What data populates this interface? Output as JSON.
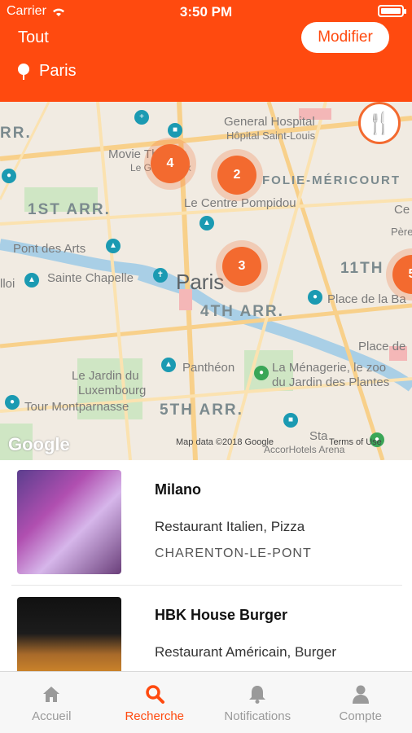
{
  "status_bar": {
    "carrier": "Carrier",
    "time": "3:50 PM"
  },
  "header": {
    "title": "Tout",
    "edit_label": "Modifier",
    "location": "Paris",
    "accent_color": "#ff4a0f"
  },
  "map": {
    "labels": {
      "arr_left": "RR.",
      "movie_theater": "Movie Theater",
      "le_grand_rex": "Le Grand Rex",
      "general_hospital": "General Hospital",
      "hopital": "Hôpital Saint-Louis",
      "folie": "FOLIE-MÉRICOURT",
      "first_arr": "1ST ARR.",
      "pompidou": "Le Centre Pompidou",
      "pont_des_arts": "Pont des Arts",
      "louvre_left": "lloi",
      "sainte_chapelle": "Sainte Chapelle",
      "paris": "Paris",
      "fourth_arr": "4TH ARR.",
      "eleventh": "11TH",
      "place_bastille": "Place de la Ba",
      "place_de": "Place de",
      "pantheon": "Panthéon",
      "menagerie_1": "La Ménagerie, le zoo",
      "menagerie_2": "du Jardin des Plantes",
      "jardin_1": "Le Jardin du",
      "jardin_2": "Luxembourg",
      "tour_montparnasse": "Tour Montparnasse",
      "fifth_arr": "5TH ARR.",
      "ce": "Ce",
      "pere": "Père",
      "accorhotels": "AccorHotels Arena",
      "sta": "Sta"
    },
    "clusters": [
      {
        "count": "4"
      },
      {
        "count": "2"
      },
      {
        "count": "3"
      },
      {
        "count": "5"
      }
    ],
    "google": "Google",
    "map_data": "Map data ©2018 Google",
    "terms": "Terms of Use"
  },
  "restaurants": [
    {
      "name": "Milano",
      "category": "Restaurant Italien, Pizza",
      "city": "CHARENTON-LE-PONT"
    },
    {
      "name": "HBK House Burger",
      "category": "Restaurant Américain, Burger",
      "city": ""
    }
  ],
  "tabs": [
    {
      "label": "Accueil",
      "icon": "home-icon"
    },
    {
      "label": "Recherche",
      "icon": "search-icon"
    },
    {
      "label": "Notifications",
      "icon": "bell-icon"
    },
    {
      "label": "Compte",
      "icon": "user-icon"
    }
  ]
}
